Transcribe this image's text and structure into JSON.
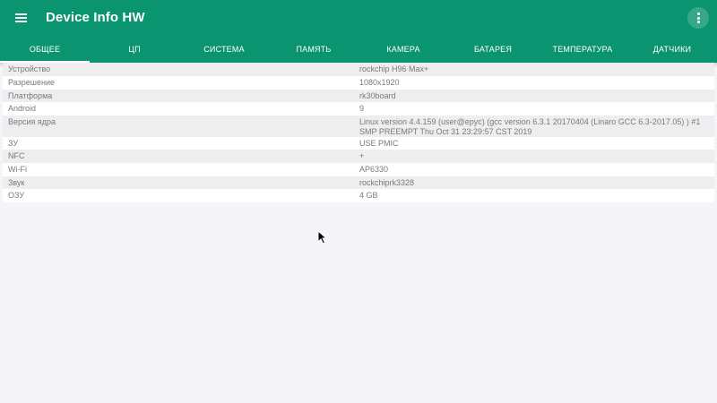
{
  "app": {
    "title": "Device Info HW"
  },
  "toolbar": {
    "menu_icon": "hamburger-menu-icon",
    "overflow_icon": "more-vertical-icon"
  },
  "tabs": [
    {
      "label": "ОБЩЕЕ",
      "active": true
    },
    {
      "label": "ЦП",
      "active": false
    },
    {
      "label": "СИСТЕМА",
      "active": false
    },
    {
      "label": "ПАМЯТЬ",
      "active": false
    },
    {
      "label": "КАМЕРА",
      "active": false
    },
    {
      "label": "БАТАРЕЯ",
      "active": false
    },
    {
      "label": "ТЕМПЕРАТУРА",
      "active": false
    },
    {
      "label": "ДАТЧИКИ",
      "active": false
    }
  ],
  "info_rows": [
    {
      "label": "Устройство",
      "value": "rockchip H96 Max+"
    },
    {
      "label": "Разрешение",
      "value": "1080x1920"
    },
    {
      "label": "Платформа",
      "value": "rk30board"
    },
    {
      "label": "Android",
      "value": "9"
    },
    {
      "label": "Версия ядра",
      "value": "Linux version 4.4.159 (user@epyc) (gcc version 6.3.1 20170404 (Linaro GCC 6.3-2017.05) ) #1 SMP PREEMPT Thu Oct 31 23:29:57 CST 2019"
    },
    {
      "label": "ЗУ",
      "value": "USE PMIC"
    },
    {
      "label": "NFC",
      "value": "+"
    },
    {
      "label": "Wi-Fi",
      "value": "AP6330"
    },
    {
      "label": "Звук",
      "value": "rockchiprk3328"
    },
    {
      "label": "ОЗУ",
      "value": "4 GB"
    }
  ],
  "colors": {
    "app_bar": "#0b9470",
    "background": "#f5f4f8",
    "row_odd": "#eeedf0",
    "row_even": "#ffffff",
    "text": "#7a7a7a"
  }
}
